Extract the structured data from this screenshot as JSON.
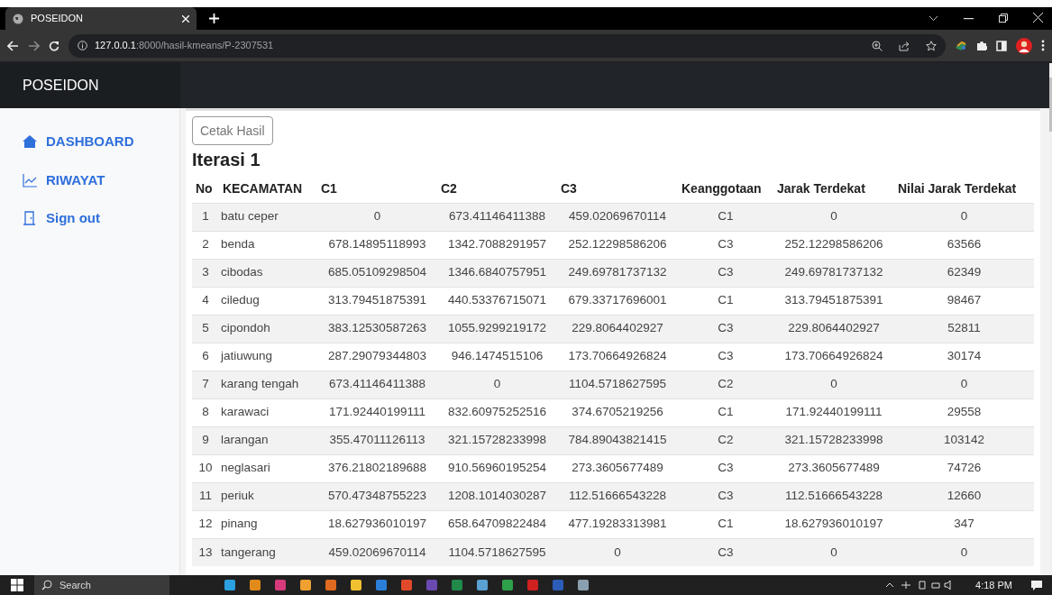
{
  "browser": {
    "tab_title": "POSEIDON",
    "url_host": "127.0.0.1",
    "url_path": ":8000/hasil-kmeans/P-2307531"
  },
  "navbar": {
    "brand": "POSEIDON"
  },
  "sidebar": {
    "items": [
      {
        "label": "DASHBOARD",
        "kind": "home"
      },
      {
        "label": "RIWAYAT",
        "kind": "history"
      },
      {
        "label": "Sign out",
        "kind": "logout"
      }
    ]
  },
  "content": {
    "print_button": "Cetak Hasil",
    "heading": "Iterasi 1",
    "table": {
      "columns": [
        "No",
        "KECAMATAN",
        "C1",
        "C2",
        "C3",
        "Keanggotaan",
        "Jarak Terdekat",
        "Nilai Jarak Terdekat"
      ],
      "rows": [
        [
          "1",
          "batu ceper",
          "0",
          "673.41146411388",
          "459.02069670114",
          "C1",
          "0",
          "0"
        ],
        [
          "2",
          "benda",
          "678.14895118993",
          "1342.7088291957",
          "252.12298586206",
          "C3",
          "252.12298586206",
          "63566"
        ],
        [
          "3",
          "cibodas",
          "685.05109298504",
          "1346.6840757951",
          "249.69781737132",
          "C3",
          "249.69781737132",
          "62349"
        ],
        [
          "4",
          "ciledug",
          "313.79451875391",
          "440.53376715071",
          "679.33717696001",
          "C1",
          "313.79451875391",
          "98467"
        ],
        [
          "5",
          "cipondoh",
          "383.12530587263",
          "1055.9299219172",
          "229.8064402927",
          "C3",
          "229.8064402927",
          "52811"
        ],
        [
          "6",
          "jatiuwung",
          "287.29079344803",
          "946.1474515106",
          "173.70664926824",
          "C3",
          "173.70664926824",
          "30174"
        ],
        [
          "7",
          "karang tengah",
          "673.41146411388",
          "0",
          "1104.5718627595",
          "C2",
          "0",
          "0"
        ],
        [
          "8",
          "karawaci",
          "171.92440199111",
          "832.60975252516",
          "374.6705219256",
          "C1",
          "171.92440199111",
          "29558"
        ],
        [
          "9",
          "larangan",
          "355.47011126113",
          "321.15728233998",
          "784.89043821415",
          "C2",
          "321.15728233998",
          "103142"
        ],
        [
          "10",
          "neglasari",
          "376.21802189688",
          "910.56960195254",
          "273.3605677489",
          "C3",
          "273.3605677489",
          "74726"
        ],
        [
          "11",
          "periuk",
          "570.47348755223",
          "1208.1014030287",
          "112.51666543228",
          "C3",
          "112.51666543228",
          "12660"
        ],
        [
          "12",
          "pinang",
          "18.627936010197",
          "658.64709822484",
          "477.19283313981",
          "C1",
          "18.627936010197",
          "347"
        ],
        [
          "13",
          "tangerang",
          "459.02069670114",
          "1104.5718627595",
          "0",
          "C3",
          "0",
          "0"
        ]
      ]
    }
  },
  "taskbar": {
    "search": "Search",
    "time": "4:18 PM"
  }
}
